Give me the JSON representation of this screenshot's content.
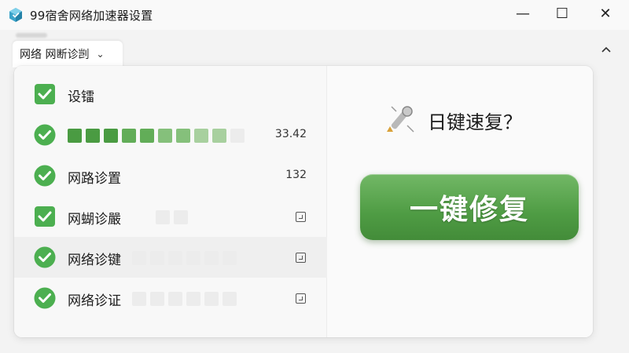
{
  "window": {
    "title": "99宿舍网络加速器设置",
    "controls": {
      "minimize": "—",
      "maximize": "☐",
      "close": "✕"
    }
  },
  "tab": {
    "label": "网络 网断诊剀",
    "chevron": "⌄",
    "collapse": "^"
  },
  "diagnostics": [
    {
      "label": "设镭",
      "value": "",
      "checkbox_style": "square"
    },
    {
      "label": "",
      "value": "33.42",
      "checkbox_style": "circle",
      "progress_segments": 10,
      "progress_filled": 9
    },
    {
      "label": "网路诊置",
      "value": "132",
      "checkbox_style": "circle"
    },
    {
      "label": "网蝴诊嚴",
      "value": "",
      "checkbox_style": "square"
    },
    {
      "label": "网络诊键",
      "value": "",
      "checkbox_style": "circle"
    },
    {
      "label": "网络诊证",
      "value": "",
      "checkbox_style": "circle"
    }
  ],
  "quick_fix": {
    "title": "日键速复？",
    "button_label": "一键修复"
  },
  "colors": {
    "accent_green": "#4f9c44",
    "check_green": "#4caf50",
    "panel_bg": "#ffffff"
  },
  "icons": {
    "app": "app-cube-icon",
    "check": "check-icon",
    "wrench": "wrench-icon",
    "expand": "expand-icon"
  }
}
